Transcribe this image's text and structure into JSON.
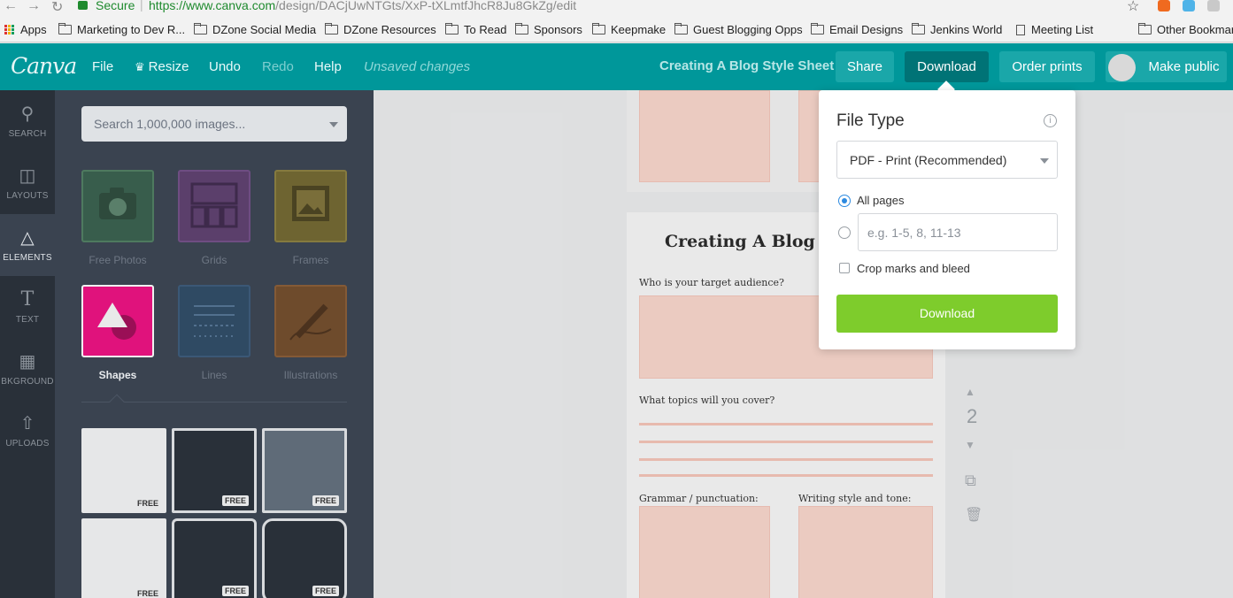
{
  "browser": {
    "secure_label": "Secure",
    "url_main": "https://www.canva.com",
    "url_path": "/design/DACjUwNTGts/XxP-tXLmtfJhcR8Ju8GkZg/edit",
    "bookmarks": [
      "Apps",
      "Marketing to Dev R...",
      "DZone Social Media",
      "DZone Resources",
      "To Read",
      "Sponsors",
      "Keepmake",
      "Guest Blogging Opps",
      "Email Designs",
      "Jenkins World",
      "Meeting List",
      "Other Bookmarks"
    ]
  },
  "topbar": {
    "logo": "Canva",
    "menu": [
      "File",
      "Resize",
      "Undo",
      "Redo",
      "Help"
    ],
    "status": "Unsaved changes",
    "doc_title": "Creating A Blog Style Sheet",
    "buttons": [
      "Share",
      "Download",
      "Order prints",
      "Make public"
    ]
  },
  "rail": [
    {
      "label": "SEARCH",
      "icon": "search-icon"
    },
    {
      "label": "LAYOUTS",
      "icon": "layouts-icon"
    },
    {
      "label": "ELEMENTS",
      "icon": "shapes-icon"
    },
    {
      "label": "TEXT",
      "icon": "text-icon"
    },
    {
      "label": "BKGROUND",
      "icon": "background-icon"
    },
    {
      "label": "UPLOADS",
      "icon": "upload-icon"
    }
  ],
  "panel": {
    "search_placeholder": "Search 1,000,000 images...",
    "categories": [
      "Free Photos",
      "Grids",
      "Frames",
      "Shapes",
      "Lines",
      "Illustrations"
    ],
    "free_badge": "FREE"
  },
  "document": {
    "heading": "Creating A Blog S",
    "q1": "Who is your target audience?",
    "q2": "What topics will you cover?",
    "q3": "Grammar / punctuation:",
    "q4": "Writing style and tone:",
    "page_number": "2"
  },
  "download_popover": {
    "title": "File Type",
    "file_type": "PDF - Print (Recommended)",
    "all_pages": "All pages",
    "range_placeholder": "e.g. 1-5, 8, 11-13",
    "crop_marks": "Crop marks and bleed",
    "button": "Download",
    "selected": "all-pages"
  },
  "colors": {
    "topbar": "#00979a",
    "download_button": "#7ecc2c",
    "shapes_tile": "#e0127c"
  }
}
